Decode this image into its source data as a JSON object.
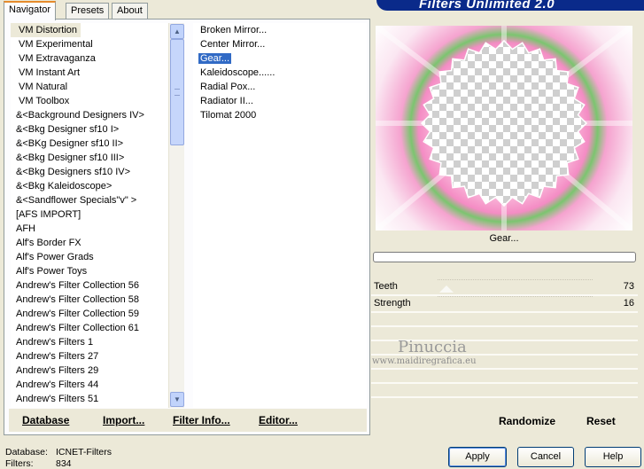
{
  "app": {
    "title": "Filters Unlimited 2.0"
  },
  "tabs": [
    {
      "label": "Navigator"
    },
    {
      "label": "Presets"
    },
    {
      "label": "About"
    }
  ],
  "categories": [
    "VM Distortion",
    "VM Experimental",
    "VM Extravaganza",
    "VM Instant Art",
    "VM Natural",
    "VM Toolbox",
    "&<Background Designers IV>",
    "&<Bkg Designer sf10 I>",
    "&<BKg Designer sf10 II>",
    "&<Bkg Designer sf10 III>",
    "&<Bkg Designers sf10 IV>",
    "&<Bkg Kaleidoscope>",
    "&<Sandflower Specials\"v\" >",
    "[AFS IMPORT]",
    "AFH",
    "Alf's Border FX",
    "Alf's Power Grads",
    "Alf's Power Toys",
    "Andrew's Filter Collection 56",
    "Andrew's Filter Collection 58",
    "Andrew's Filter Collection 59",
    "Andrew's Filter Collection 61",
    "Andrew's Filters 1",
    "Andrew's Filters 27",
    "Andrew's Filters 29",
    "Andrew's Filters 44",
    "Andrew's Filters 51"
  ],
  "filters": [
    "Broken Mirror...",
    "Center Mirror...",
    "Gear...",
    "Kaleidoscope......",
    "Radial Pox...",
    "Radiator II...",
    "Tilomat 2000"
  ],
  "toolbar": {
    "database": "Database",
    "import": "Import...",
    "filter_info": "Filter Info...",
    "editor": "Editor..."
  },
  "preview": {
    "filter_name": "Gear..."
  },
  "sliders": [
    {
      "label": "Teeth",
      "value": "73"
    },
    {
      "label": "Strength",
      "value": "16"
    }
  ],
  "watermark": {
    "name": "Pinuccia",
    "site": "www.maidiregrafica.eu"
  },
  "actions": {
    "randomize": "Randomize",
    "reset": "Reset"
  },
  "status": {
    "database_label": "Database:",
    "database_value": "ICNET-Filters",
    "filters_label": "Filters:",
    "filters_value": "834"
  },
  "buttons": {
    "apply": "Apply",
    "cancel": "Cancel",
    "help": "Help"
  }
}
